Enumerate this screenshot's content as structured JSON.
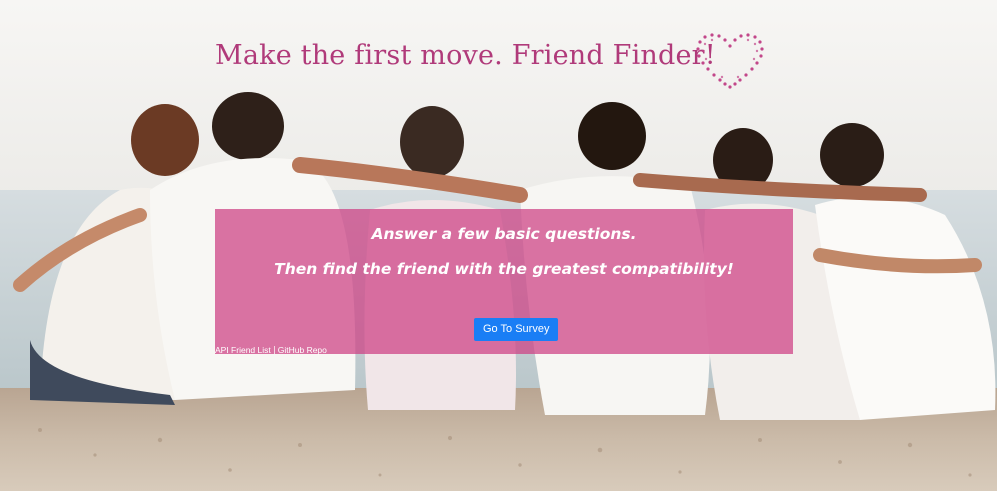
{
  "header": {
    "title": "Make the first move. Friend Finder!",
    "title_color": "#b03a7a",
    "heart_icon": "dotted-heart-icon"
  },
  "jumbotron": {
    "line1": "Answer a few basic questions.",
    "line2": "Then find the friend with the greatest compatibility!",
    "overlay_color": "#cd3e82",
    "button_label": "Go To Survey",
    "button_color": "#1a7ef5"
  },
  "footer": {
    "links": [
      "API Friend List",
      "GitHub Repo"
    ]
  },
  "background": {
    "scene": "friends-sitting-on-beach-photo",
    "sky_color": "#f4f2ef",
    "sea_color": "#c9d3d6",
    "sand_color": "#c8b8a6"
  }
}
